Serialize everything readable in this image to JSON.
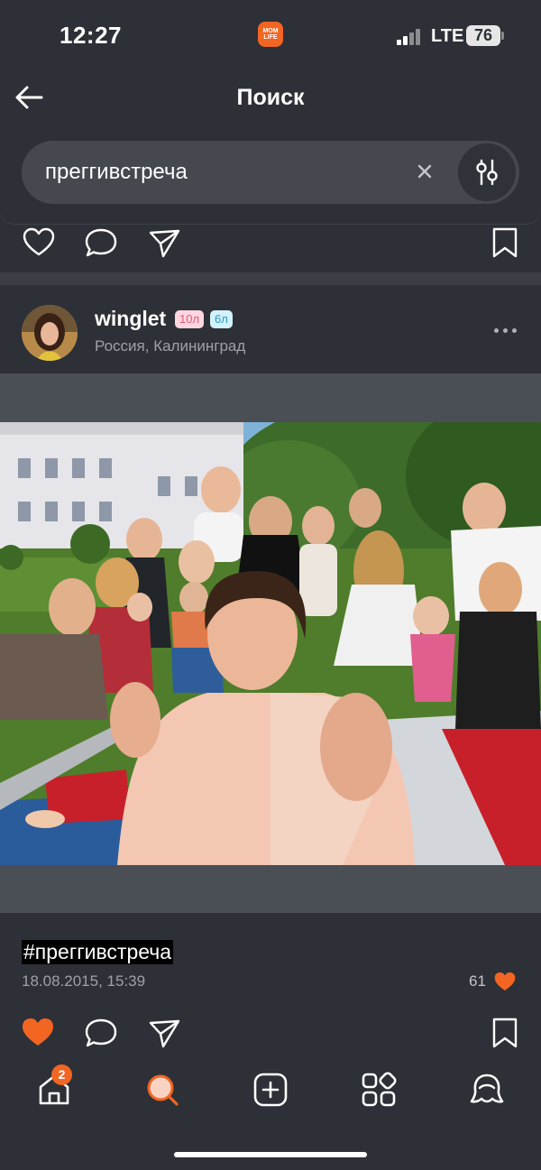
{
  "status_bar": {
    "time": "12:27",
    "app_badge": [
      "MOM",
      "LIFE"
    ],
    "network": "LTE",
    "battery": "76"
  },
  "header": {
    "title": "Поиск",
    "search_value": "преггивстреча"
  },
  "post": {
    "username": "winglet",
    "child_badges": [
      "10л",
      "6л"
    ],
    "location": "Россия, Калининград",
    "hashtag": "#преггивстреча",
    "date": "18.08.2015, 15:39",
    "likes": "61",
    "liked": true
  },
  "tab_bar": {
    "home_badge": "2",
    "active_tab": "search"
  },
  "colors": {
    "background": "#2d3036",
    "accent": "#f26522",
    "search_field": "#45484f",
    "separator": "#3b3f45"
  },
  "icons": [
    "back-arrow-icon",
    "close-icon",
    "filter-sliders-icon",
    "heart-icon",
    "comment-icon",
    "share-send-icon",
    "bookmark-icon",
    "more-dots-icon",
    "home-icon",
    "search-icon",
    "add-post-icon",
    "services-grid-icon",
    "profile-icon"
  ]
}
